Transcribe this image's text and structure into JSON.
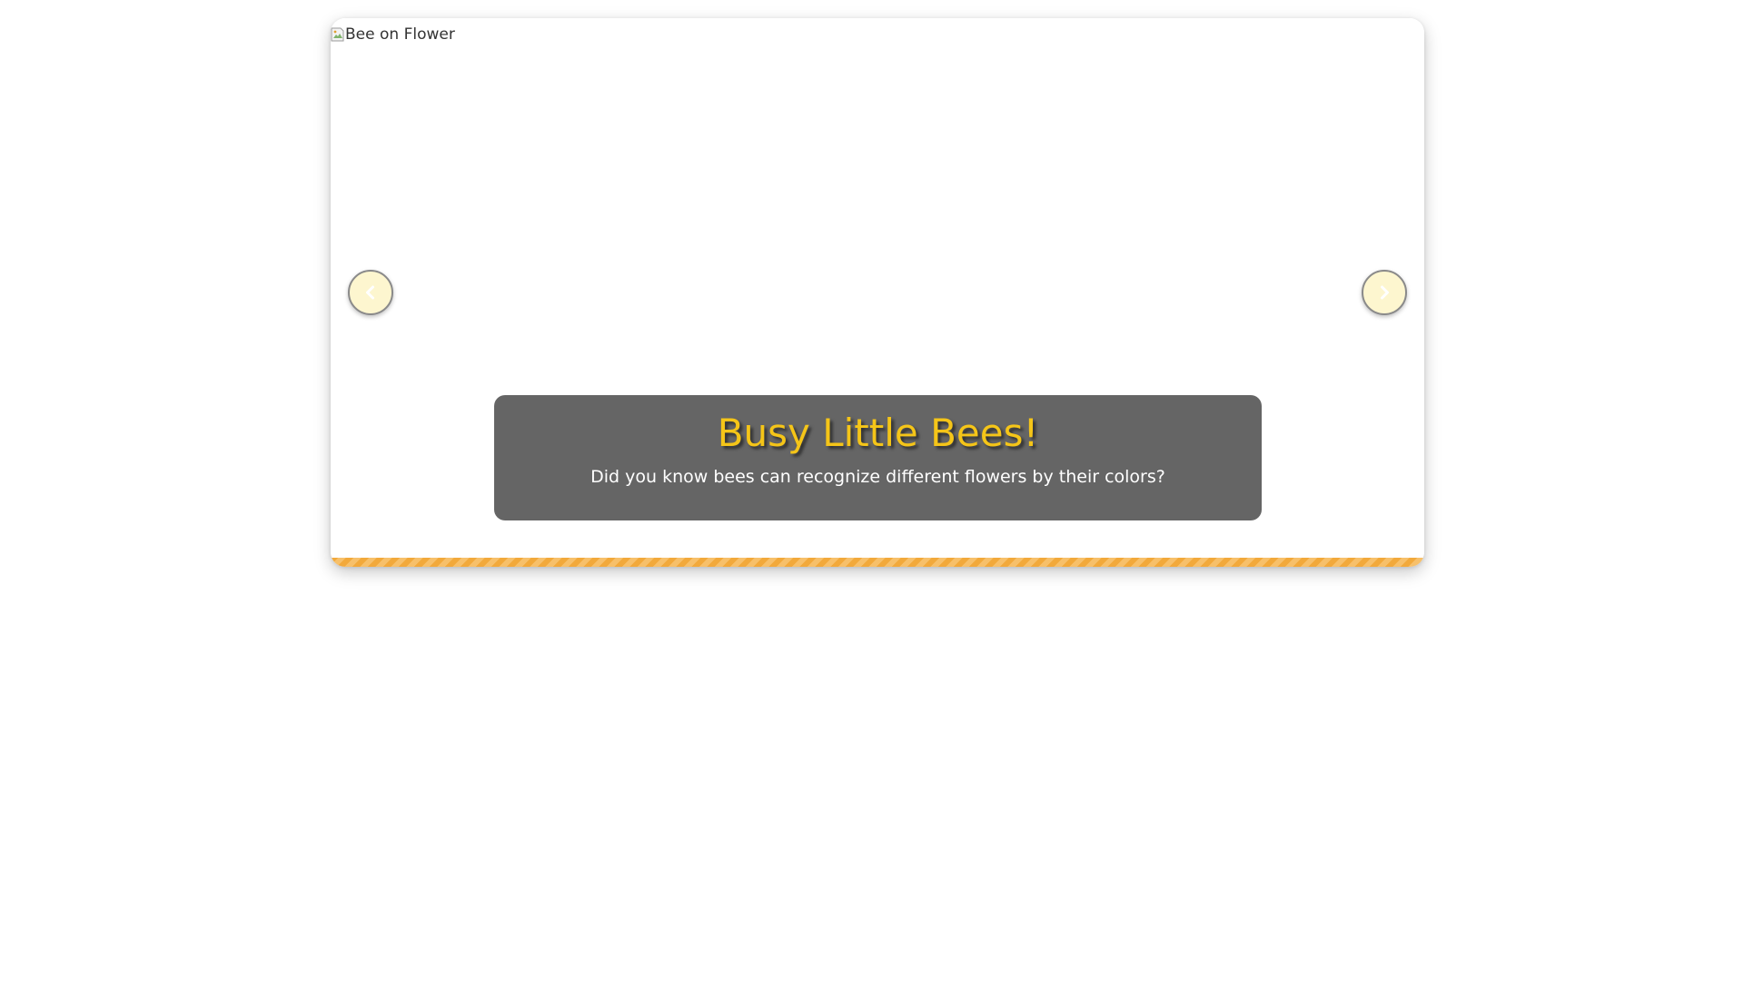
{
  "carousel": {
    "image_alt": "Bee on Flower",
    "caption": {
      "title": "Busy Little Bees!",
      "text": "Did you know bees can recognize different flowers by their colors?"
    },
    "prev_icon": "chevron-left-icon",
    "next_icon": "chevron-right-icon"
  },
  "colors": {
    "title": "#f5c518",
    "caption_bg": "#505050",
    "nav_bg": "#fdf6cf",
    "honey_bar": "#f2a93b"
  }
}
